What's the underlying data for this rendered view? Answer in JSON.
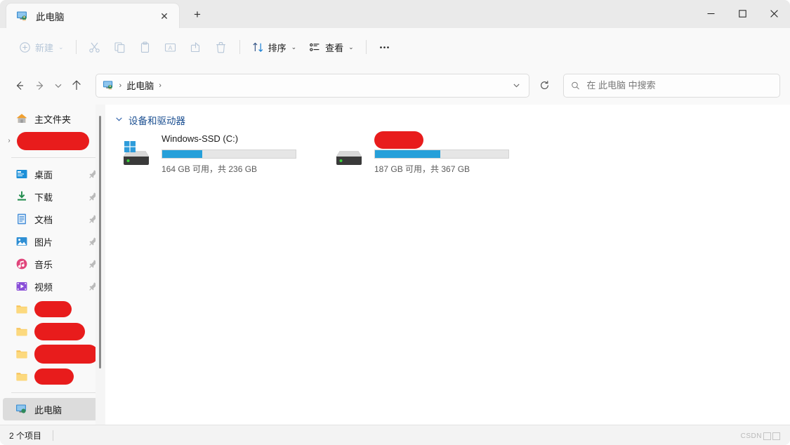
{
  "window": {
    "controls": {
      "minimize": "—",
      "maximize": "□",
      "close": "✕"
    }
  },
  "tabs": {
    "items": [
      {
        "label": "此电脑",
        "icon": "this-pc-icon",
        "close": "✕",
        "active": true
      }
    ],
    "new_tab": "+"
  },
  "toolbar": {
    "new_label": "新建",
    "cut_label": "剪切",
    "copy_label": "复制",
    "paste_label": "粘贴",
    "rename_label": "重命名",
    "share_label": "共享",
    "delete_label": "删除",
    "sort_label": "排序",
    "view_label": "查看",
    "more_label": "•••",
    "chevron": "⌄"
  },
  "navbar": {
    "back": "←",
    "forward": "→",
    "recent": "⌄",
    "up": "↑",
    "breadcrumb": {
      "icon": "this-pc-icon",
      "sep1": "›",
      "label": "此电脑",
      "sep2": "›"
    },
    "address_chevron": "⌄",
    "refresh": "⟳"
  },
  "search": {
    "placeholder": "在 此电脑 中搜索",
    "icon": "search-icon"
  },
  "sidebar": {
    "items": [
      {
        "label": "主文件夹",
        "icon": "home-icon",
        "pinned": false,
        "redacted": false,
        "expander": ""
      },
      {
        "label": "",
        "icon": "onedrive-icon",
        "pinned": false,
        "redacted": true,
        "redact_w": 103,
        "expander": "›"
      },
      {
        "label": "桌面",
        "icon": "desktop-icon",
        "pinned": true,
        "redacted": false,
        "expander": ""
      },
      {
        "label": "下载",
        "icon": "downloads-icon",
        "pinned": true,
        "redacted": false,
        "expander": ""
      },
      {
        "label": "文档",
        "icon": "documents-icon",
        "pinned": true,
        "redacted": false,
        "expander": ""
      },
      {
        "label": "图片",
        "icon": "pictures-icon",
        "pinned": true,
        "redacted": false,
        "expander": ""
      },
      {
        "label": "音乐",
        "icon": "music-icon",
        "pinned": true,
        "redacted": false,
        "expander": ""
      },
      {
        "label": "视频",
        "icon": "videos-icon",
        "pinned": true,
        "redacted": false,
        "expander": ""
      },
      {
        "label": "",
        "icon": "folder-icon",
        "pinned": false,
        "redacted": true,
        "redact_w": 53,
        "expander": ""
      },
      {
        "label": "",
        "icon": "folder-icon",
        "pinned": false,
        "redacted": true,
        "redact_w": 72,
        "expander": ""
      },
      {
        "label": "",
        "icon": "folder-icon",
        "pinned": false,
        "redacted": true,
        "redact_w": 95,
        "expander": ""
      },
      {
        "label": "",
        "icon": "folder-icon",
        "pinned": false,
        "redacted": true,
        "redact_w": 56,
        "expander": ""
      }
    ],
    "selected_item": {
      "label": "此电脑",
      "icon": "this-pc-icon"
    }
  },
  "content": {
    "group": {
      "title": "设备和驱动器",
      "chevron": "⌄",
      "expanded": true
    },
    "drives": [
      {
        "name": "Windows-SSD (C:)",
        "redacted": false,
        "free_text": "164 GB 可用，共 236 GB",
        "free_gb": 164,
        "total_gb": 236,
        "used_percent": 30,
        "icon": "windows-drive-icon"
      },
      {
        "name": "",
        "redacted": true,
        "redact_w": 70,
        "free_text": "187 GB 可用，共 367 GB",
        "free_gb": 187,
        "total_gb": 367,
        "used_percent": 49,
        "icon": "drive-icon"
      }
    ]
  },
  "statusbar": {
    "item_count": "2 个项目"
  },
  "watermark": {
    "text": "CSDN"
  },
  "colors": {
    "accent_blue": "#26a0da",
    "group_title": "#1b4f91",
    "redaction": "#e81c1c",
    "window_bg": "#f3f3f3",
    "content_bg": "#ffffff",
    "sidebar_bg": "#f9f9f9"
  }
}
